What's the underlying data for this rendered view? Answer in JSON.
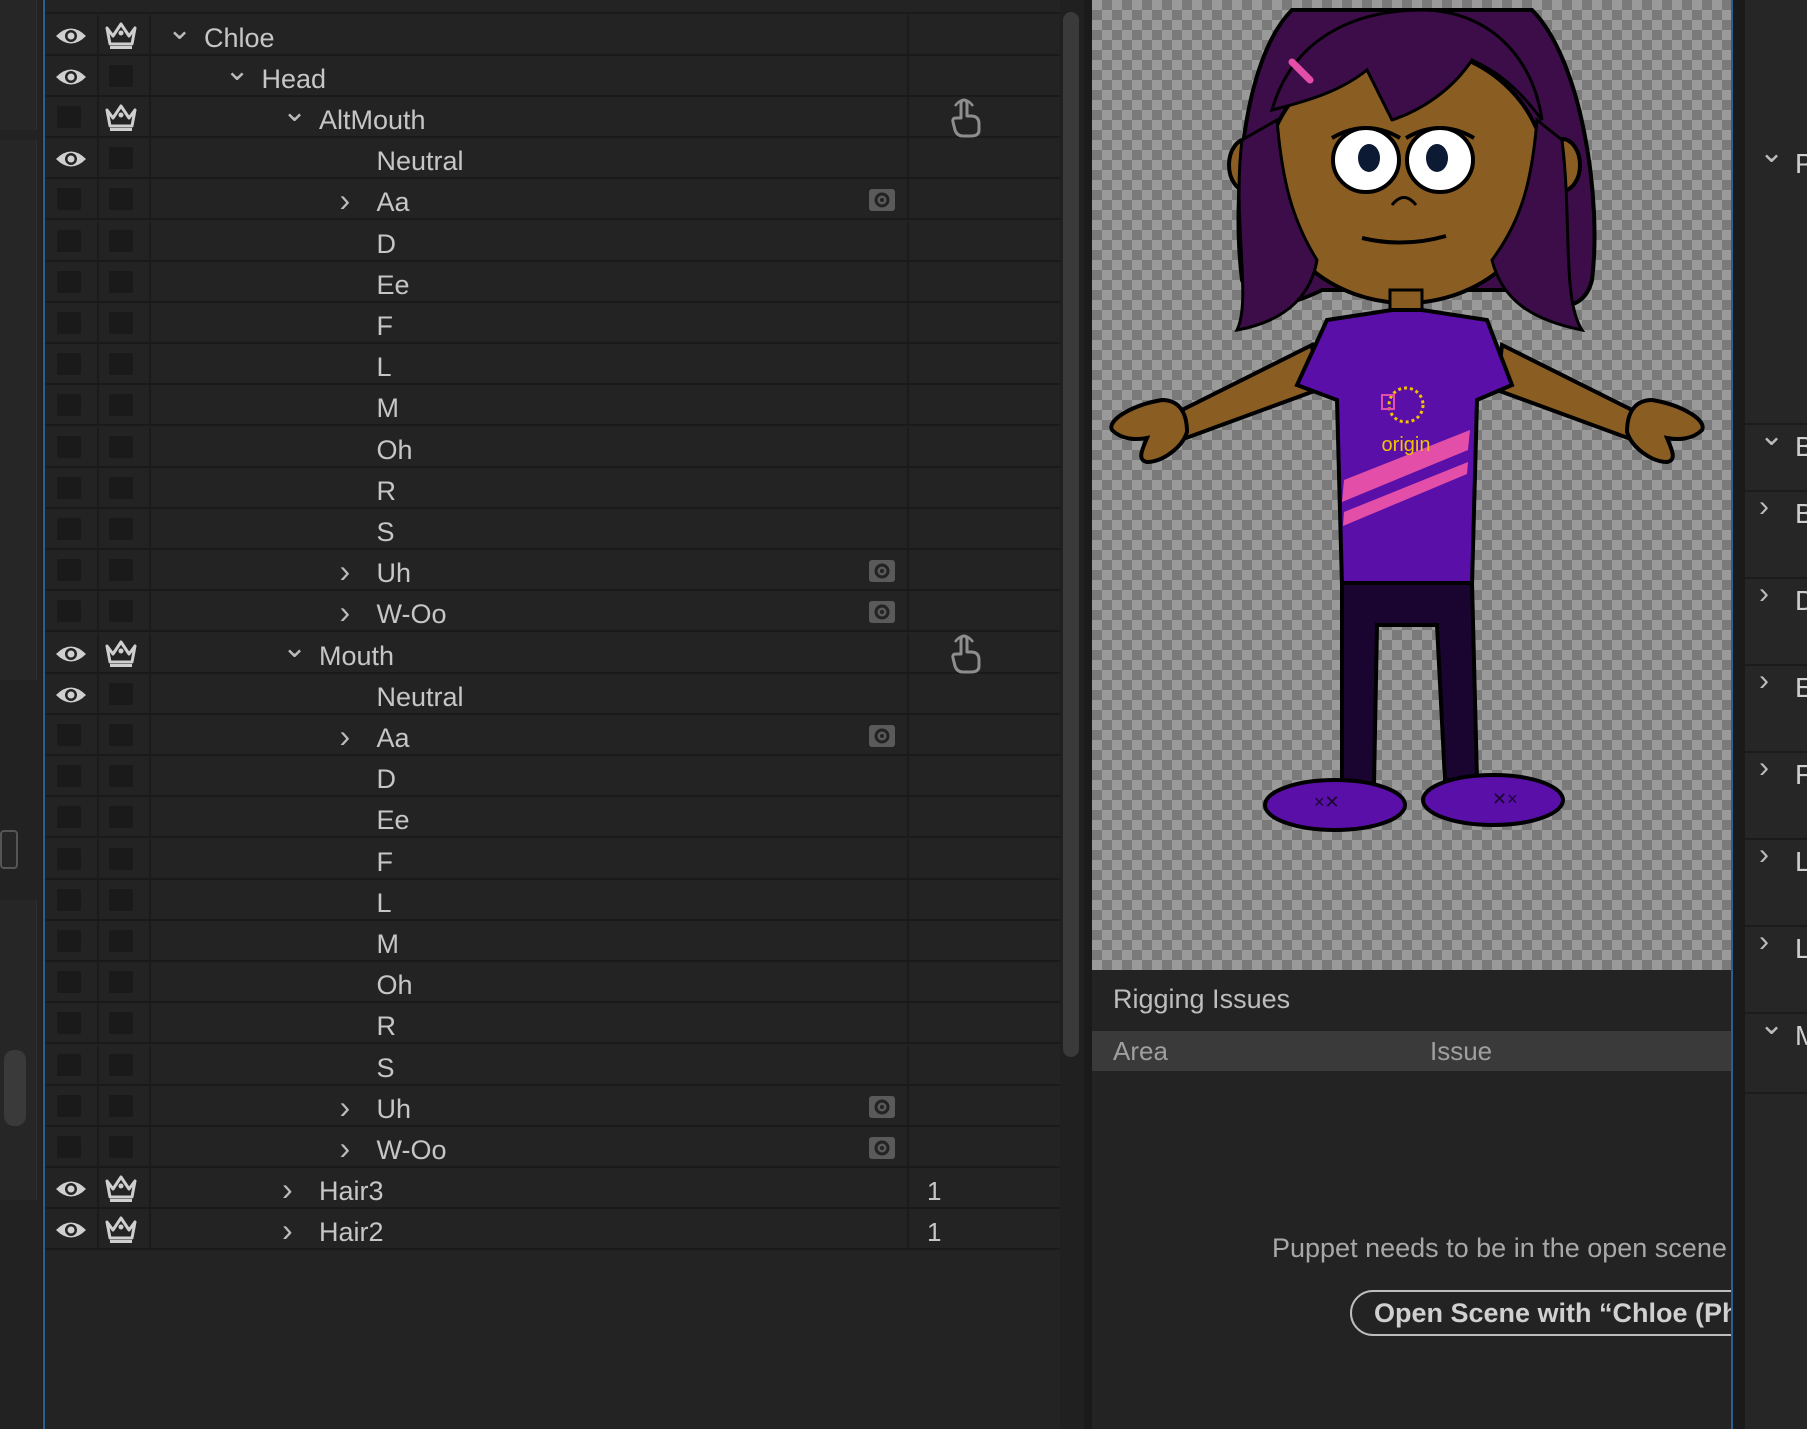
{
  "layers": [
    {
      "name": "Chloe",
      "depth": 0,
      "expand": "open",
      "eye": true,
      "crown": true,
      "extra": "",
      "extra_icon": ""
    },
    {
      "name": "Head",
      "depth": 1,
      "expand": "open",
      "eye": true,
      "crown": false,
      "extra": "",
      "extra_icon": ""
    },
    {
      "name": "AltMouth",
      "depth": 2,
      "expand": "open",
      "eye": false,
      "crown": true,
      "extra": "",
      "extra_icon": "hand"
    },
    {
      "name": "Neutral",
      "depth": 3,
      "expand": "none",
      "eye": true,
      "crown": false,
      "extra": "",
      "extra_icon": ""
    },
    {
      "name": "Aa",
      "depth": 3,
      "expand": "closed",
      "eye": false,
      "crown": false,
      "extra": "",
      "extra_icon": "gear"
    },
    {
      "name": "D",
      "depth": 3,
      "expand": "none",
      "eye": false,
      "crown": false,
      "extra": "",
      "extra_icon": ""
    },
    {
      "name": "Ee",
      "depth": 3,
      "expand": "none",
      "eye": false,
      "crown": false,
      "extra": "",
      "extra_icon": ""
    },
    {
      "name": "F",
      "depth": 3,
      "expand": "none",
      "eye": false,
      "crown": false,
      "extra": "",
      "extra_icon": ""
    },
    {
      "name": "L",
      "depth": 3,
      "expand": "none",
      "eye": false,
      "crown": false,
      "extra": "",
      "extra_icon": ""
    },
    {
      "name": "M",
      "depth": 3,
      "expand": "none",
      "eye": false,
      "crown": false,
      "extra": "",
      "extra_icon": ""
    },
    {
      "name": "Oh",
      "depth": 3,
      "expand": "none",
      "eye": false,
      "crown": false,
      "extra": "",
      "extra_icon": ""
    },
    {
      "name": "R",
      "depth": 3,
      "expand": "none",
      "eye": false,
      "crown": false,
      "extra": "",
      "extra_icon": ""
    },
    {
      "name": "S",
      "depth": 3,
      "expand": "none",
      "eye": false,
      "crown": false,
      "extra": "",
      "extra_icon": ""
    },
    {
      "name": "Uh",
      "depth": 3,
      "expand": "closed",
      "eye": false,
      "crown": false,
      "extra": "",
      "extra_icon": "gear"
    },
    {
      "name": "W-Oo",
      "depth": 3,
      "expand": "closed",
      "eye": false,
      "crown": false,
      "extra": "",
      "extra_icon": "gear"
    },
    {
      "name": "Mouth",
      "depth": 2,
      "expand": "open",
      "eye": true,
      "crown": true,
      "extra": "",
      "extra_icon": "hand"
    },
    {
      "name": "Neutral",
      "depth": 3,
      "expand": "none",
      "eye": true,
      "crown": false,
      "extra": "",
      "extra_icon": ""
    },
    {
      "name": "Aa",
      "depth": 3,
      "expand": "closed",
      "eye": false,
      "crown": false,
      "extra": "",
      "extra_icon": "gear"
    },
    {
      "name": "D",
      "depth": 3,
      "expand": "none",
      "eye": false,
      "crown": false,
      "extra": "",
      "extra_icon": ""
    },
    {
      "name": "Ee",
      "depth": 3,
      "expand": "none",
      "eye": false,
      "crown": false,
      "extra": "",
      "extra_icon": ""
    },
    {
      "name": "F",
      "depth": 3,
      "expand": "none",
      "eye": false,
      "crown": false,
      "extra": "",
      "extra_icon": ""
    },
    {
      "name": "L",
      "depth": 3,
      "expand": "none",
      "eye": false,
      "crown": false,
      "extra": "",
      "extra_icon": ""
    },
    {
      "name": "M",
      "depth": 3,
      "expand": "none",
      "eye": false,
      "crown": false,
      "extra": "",
      "extra_icon": ""
    },
    {
      "name": "Oh",
      "depth": 3,
      "expand": "none",
      "eye": false,
      "crown": false,
      "extra": "",
      "extra_icon": ""
    },
    {
      "name": "R",
      "depth": 3,
      "expand": "none",
      "eye": false,
      "crown": false,
      "extra": "",
      "extra_icon": ""
    },
    {
      "name": "S",
      "depth": 3,
      "expand": "none",
      "eye": false,
      "crown": false,
      "extra": "",
      "extra_icon": ""
    },
    {
      "name": "Uh",
      "depth": 3,
      "expand": "closed",
      "eye": false,
      "crown": false,
      "extra": "",
      "extra_icon": "gear"
    },
    {
      "name": "W-Oo",
      "depth": 3,
      "expand": "closed",
      "eye": false,
      "crown": false,
      "extra": "",
      "extra_icon": "gear"
    },
    {
      "name": "Hair3",
      "depth": 2,
      "expand": "closed",
      "eye": true,
      "crown": true,
      "extra": "1",
      "extra_icon": ""
    },
    {
      "name": "Hair2",
      "depth": 2,
      "expand": "closed",
      "eye": true,
      "crown": true,
      "extra": "1",
      "extra_icon": ""
    }
  ],
  "preview": {
    "origin_label": "origin"
  },
  "rigging": {
    "title": "Rigging Issues",
    "col_area": "Area",
    "col_issue": "Issue",
    "message": "Puppet needs to be in the open scene",
    "button_label": "Open Scene with “Chloe (Ph"
  },
  "properties": [
    {
      "letter": "P",
      "expand": "open"
    },
    {
      "letter": "B",
      "expand": "open"
    },
    {
      "letter": "B",
      "expand": "closed"
    },
    {
      "letter": "D",
      "expand": "closed"
    },
    {
      "letter": "E",
      "expand": "closed"
    },
    {
      "letter": "F",
      "expand": "closed"
    },
    {
      "letter": "L",
      "expand": "closed"
    },
    {
      "letter": "L",
      "expand": "closed"
    },
    {
      "letter": "M",
      "expand": "open"
    }
  ],
  "colors": {
    "panel_bg": "#232323",
    "accent_line": "#2a5f96",
    "skin": "#8a5e22",
    "hair": "#3d0d4a",
    "shirt": "#5a0fa8",
    "stripe": "#e34fa8",
    "pants": "#1a0530"
  }
}
